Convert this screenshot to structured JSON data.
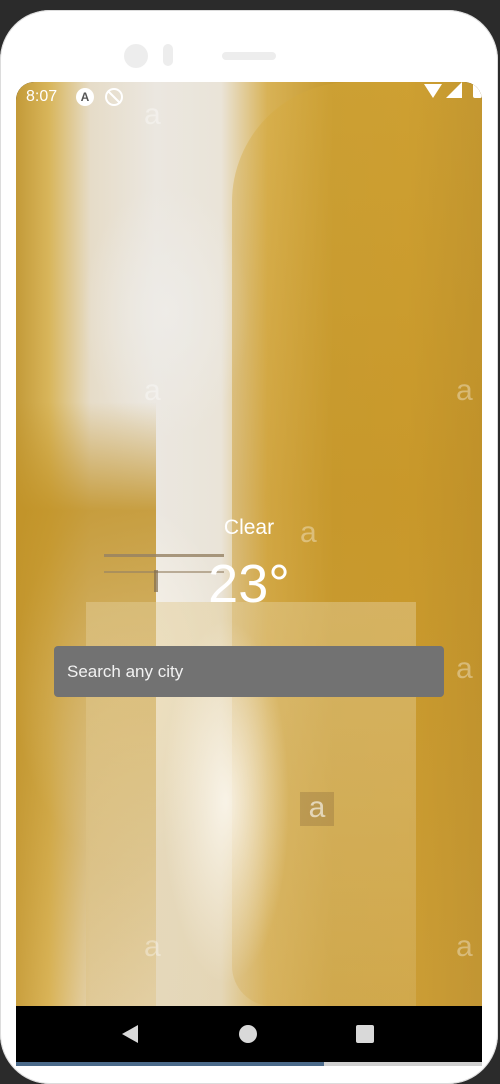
{
  "status_bar": {
    "time": "8:07",
    "notification_icons": [
      "a-badge-icon",
      "do-not-disturb-icon"
    ],
    "system_icons": [
      "wifi-icon",
      "signal-icon",
      "battery-icon"
    ]
  },
  "weather": {
    "condition": "Clear",
    "temperature": "23°"
  },
  "search": {
    "placeholder": "Search any city",
    "value": ""
  },
  "background": {
    "watermark_text": "a"
  },
  "nav_bar": {
    "buttons": [
      "back-icon",
      "home-icon",
      "recents-icon"
    ],
    "progress": 0.66
  },
  "colors": {
    "search_bg": "#727272",
    "text": "#ffffff",
    "nav_bg": "#000000"
  }
}
